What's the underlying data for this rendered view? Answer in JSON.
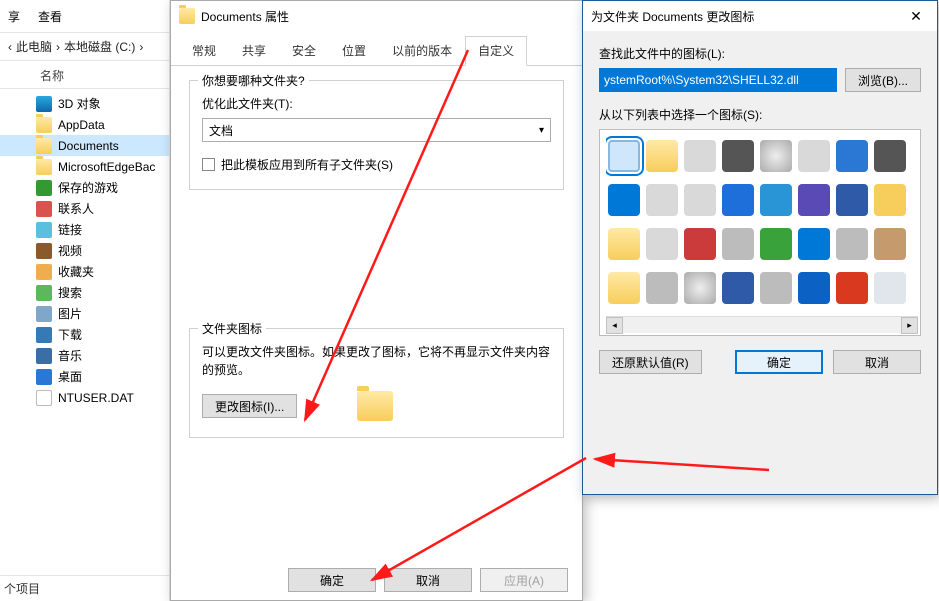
{
  "explorer": {
    "menu_share": "享",
    "menu_view": "查看",
    "bc_back": "‹",
    "bc_this_pc": "此电脑",
    "bc_drive": "本地磁盘 (C:)",
    "name_header": "名称",
    "items": [
      {
        "label": "3D 对象",
        "icon": "3d"
      },
      {
        "label": "AppData",
        "icon": "folder"
      },
      {
        "label": "Documents",
        "icon": "folder",
        "selected": true
      },
      {
        "label": "MicrosoftEdgeBac",
        "icon": "folder"
      },
      {
        "label": "保存的游戏",
        "icon": "game"
      },
      {
        "label": "联系人",
        "icon": "contact"
      },
      {
        "label": "链接",
        "icon": "link"
      },
      {
        "label": "视频",
        "icon": "video"
      },
      {
        "label": "收藏夹",
        "icon": "fav"
      },
      {
        "label": "搜索",
        "icon": "search"
      },
      {
        "label": "图片",
        "icon": "pic"
      },
      {
        "label": "下载",
        "icon": "down"
      },
      {
        "label": "音乐",
        "icon": "music"
      },
      {
        "label": "桌面",
        "icon": "desktop"
      },
      {
        "label": "NTUSER.DAT",
        "icon": "generic"
      }
    ],
    "footer": "个项目"
  },
  "prop": {
    "title": "Documents 属性",
    "tabs": [
      "常规",
      "共享",
      "安全",
      "位置",
      "以前的版本",
      "自定义"
    ],
    "active_tab": 5,
    "group1_label": "你想要哪种文件夹?",
    "optimize_label": "优化此文件夹(T):",
    "combo_value": "文档",
    "apply_sub_label": "把此模板应用到所有子文件夹(S)",
    "group2_label": "文件夹图标",
    "icon_desc": "可以更改文件夹图标。如果更改了图标，它将不再显示文件夹内容的预览。",
    "change_icon_btn": "更改图标(I)...",
    "ok": "确定",
    "cancel": "取消",
    "apply": "应用(A)"
  },
  "icondlg": {
    "title": "为文件夹 Documents 更改图标",
    "find_label": "查找此文件中的图标(L):",
    "path_value": "ystemRoot%\\System32\\SHELL32.dll",
    "browse": "浏览(B)...",
    "select_label": "从以下列表中选择一个图标(S):",
    "restore": "还原默认值(R)",
    "ok": "确定",
    "cancel": "取消",
    "icons": [
      "doc",
      "fold",
      "drive",
      "chip",
      "cd",
      "drive",
      "net",
      "chip",
      "win",
      "drive",
      "drive",
      "ie",
      "globe",
      "purple",
      "mon",
      "yellow",
      "fold",
      "drive",
      "red",
      "gray",
      "green",
      "win",
      "gray",
      "tool",
      "fold",
      "gray",
      "cd",
      "mon",
      "gray",
      "help",
      "power",
      "recycle"
    ]
  }
}
